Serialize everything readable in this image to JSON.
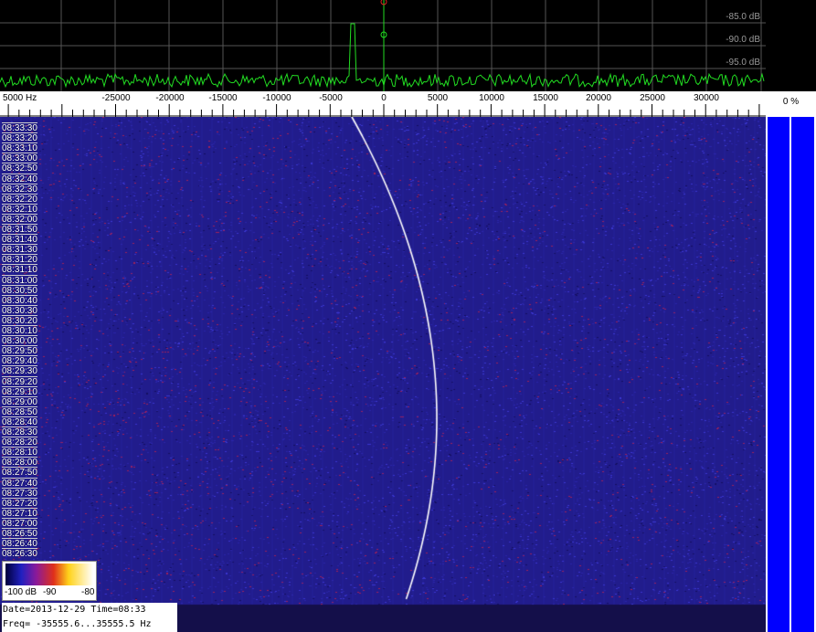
{
  "spectrum": {
    "db_labels": [
      "-85.0 dB",
      "-90.0 dB",
      "-95.0 dB"
    ],
    "trace_color": "#22dd22",
    "grid_color": "#555555"
  },
  "axis": {
    "unit_label": "5000 Hz",
    "tick_labels": [
      "-25000",
      "-20000",
      "-15000",
      "-10000",
      "-5000",
      "0",
      "5000",
      "10000",
      "15000",
      "20000",
      "25000",
      "30000"
    ]
  },
  "waterfall": {
    "time_labels": [
      "08:33:30",
      "08:33:20",
      "08:33:10",
      "08:33:00",
      "08:32:50",
      "08:32:40",
      "08:32:30",
      "08:32:20",
      "08:32:10",
      "08:32:00",
      "08:31:50",
      "08:31:40",
      "08:31:30",
      "08:31:20",
      "08:31:10",
      "08:31:00",
      "08:30:50",
      "08:30:40",
      "08:30:30",
      "08:30:20",
      "08:30:10",
      "08:30:00",
      "08:29:50",
      "08:29:40",
      "08:29:30",
      "08:29:20",
      "08:29:10",
      "08:29:00",
      "08:28:50",
      "08:28:40",
      "08:28:30",
      "08:28:20",
      "08:28:10",
      "08:28:00",
      "08:27:50",
      "08:27:40",
      "08:27:30",
      "08:27:20",
      "08:27:10",
      "08:27:00",
      "08:26:50",
      "08:26:40",
      "08:26:30"
    ]
  },
  "legend": {
    "ticks": [
      "-100 dB",
      "-90",
      "-80"
    ]
  },
  "status": {
    "date_time": "Date=2013-12-29 Time=08:33",
    "freq_range": "Freq= -35555.6...35555.5 Hz"
  },
  "right_panel": {
    "percent": "0 %"
  }
}
